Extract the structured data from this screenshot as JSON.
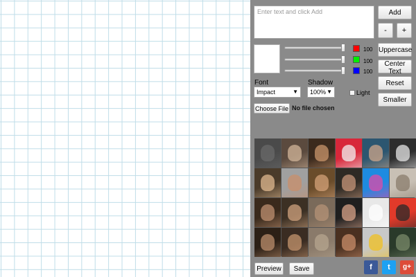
{
  "editor": {
    "text_placeholder": "Enter text and click Add",
    "buttons": {
      "add": "Add",
      "minus": "-",
      "plus": "+",
      "uppercase": "Uppercase",
      "center_text": "Center Text",
      "reset": "Reset",
      "smaller": "Smaller",
      "preview": "Preview",
      "save": "Save"
    },
    "color_sliders": [
      {
        "name": "red",
        "swatch": "#ff0000",
        "value": "100"
      },
      {
        "name": "green",
        "swatch": "#00ee00",
        "value": "100"
      },
      {
        "name": "blue",
        "swatch": "#0000ff",
        "value": "100"
      }
    ],
    "font": {
      "label": "Font",
      "selected": "Impact"
    },
    "shadow": {
      "label": "Shadow",
      "selected": "100%"
    },
    "light": {
      "label": "Light",
      "checked": false
    },
    "file": {
      "button": "Choose File",
      "status": "No file chosen"
    }
  },
  "thumbnails": {
    "count": 24,
    "colors": [
      [
        "#4a4a4a",
        "#6a6a6a"
      ],
      [
        "#5b4a3e",
        "#d2b59a"
      ],
      [
        "#3b2a1d",
        "#c9956b"
      ],
      [
        "#d8273a",
        "#f2f2f2"
      ],
      [
        "#2c5670",
        "#cda68a"
      ],
      [
        "#2d2d2d",
        "#e5e5e5"
      ],
      [
        "#4a3b2a",
        "#e0ba90"
      ],
      [
        "#a0a0a0",
        "#c98f6b"
      ],
      [
        "#6a4c2a",
        "#d4a178"
      ],
      [
        "#2e2a24",
        "#c8977a"
      ],
      [
        "#1e8be0",
        "#e04aa8"
      ],
      [
        "#c8c0b5",
        "#8a7c6c"
      ],
      [
        "#3a2a1c",
        "#bf9070"
      ],
      [
        "#3c3024",
        "#cfa27d"
      ],
      [
        "#7a6a5a",
        "#b59377"
      ],
      [
        "#1f1f1f",
        "#d9a48a"
      ],
      [
        "#e8e8e8",
        "#ffffff"
      ],
      [
        "#e23a2a",
        "#2a2a2a"
      ],
      [
        "#2c2016",
        "#bb8e6c"
      ],
      [
        "#3a2c22",
        "#c4946e"
      ],
      [
        "#8a7a6a",
        "#b5a58f"
      ],
      [
        "#4a3020",
        "#c98e6a"
      ],
      [
        "#c8c8c8",
        "#f0c020"
      ],
      [
        "#2a3a2a",
        "#7a8a6a"
      ]
    ]
  },
  "social": {
    "facebook": {
      "glyph": "f",
      "color": "#3b5998"
    },
    "twitter": {
      "glyph": "t",
      "color": "#1da1f2"
    },
    "googleplus": {
      "glyph": "g+",
      "color": "#dd4b39"
    }
  }
}
